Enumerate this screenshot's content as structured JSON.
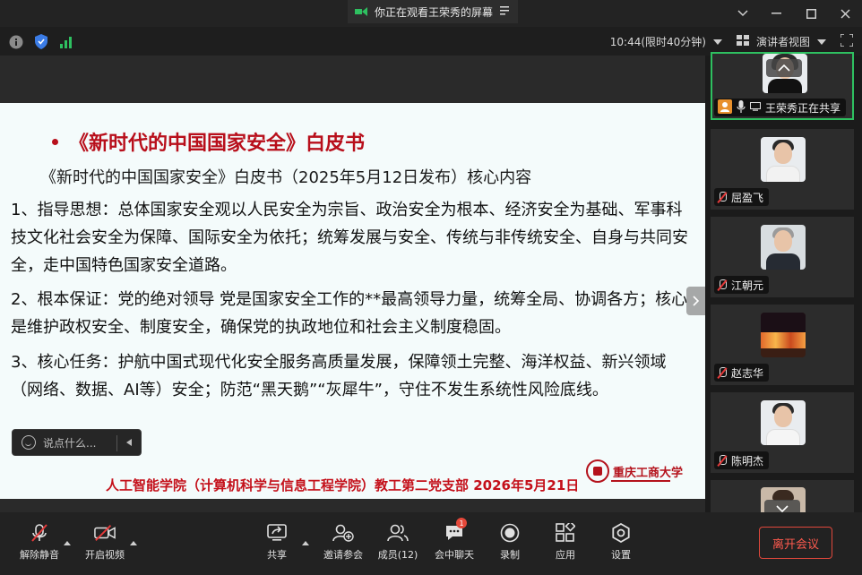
{
  "titlebar": {
    "banner": "你正在观看王荣秀的屏幕",
    "window_controls": [
      "chevron-down-icon",
      "minimize-icon",
      "maximize-icon",
      "close-icon"
    ]
  },
  "infobar": {
    "time": "10:44(限时40分钟)",
    "view_mode": "演讲者视图"
  },
  "slide": {
    "title": "《新时代的中国国家安全》白皮书",
    "subtitle": "《新时代的中国国家安全》白皮书（2025年5月12日发布）核心内容",
    "paragraphs": [
      "1、指导思想：总体国家安全观以人民安全为宗旨、政治安全为根本、经济安全为基础、军事科技文化社会安全为保障、国际安全为依托；统筹发展与安全、传统与非传统安全、自身与共同安全，走中国特色国家安全道路。",
      "2、根本保证：党的绝对领导 党是国家安全工作的**最高领导力量，统筹全局、协调各方；核心是维护政权安全、制度安全，确保党的执政地位和社会主义制度稳固。",
      "3、核心任务：护航中国式现代化安全服务高质量发展，保障领土完整、海洋权益、新兴领域（网络、数据、AI等）安全；防范“黑天鹅”“灰犀牛”，守住不发生系统性风险底线。"
    ],
    "footer": "人工智能学院（计算机科学与信息工程学院）教工第二党支部 2026年5月21日",
    "university": "重庆工商大学"
  },
  "chat": {
    "placeholder": "说点什么..."
  },
  "participants": [
    {
      "name": "王荣秀正在共享",
      "active": true
    },
    {
      "name": "屈盈飞"
    },
    {
      "name": "江朝元"
    },
    {
      "name": "赵志华"
    },
    {
      "name": "陈明杰"
    }
  ],
  "toolbar": {
    "mute": "解除静音",
    "video": "开启视频",
    "share": "共享",
    "invite": "邀请参会",
    "members": "成员(12)",
    "chat": "会中聊天",
    "chat_badge": "1",
    "record": "录制",
    "apps": "应用",
    "settings": "设置",
    "leave": "离开会议"
  },
  "colors": {
    "accent_green": "#2ec060",
    "slide_red": "#b80f1b",
    "leave_red": "#ff5a4e"
  }
}
